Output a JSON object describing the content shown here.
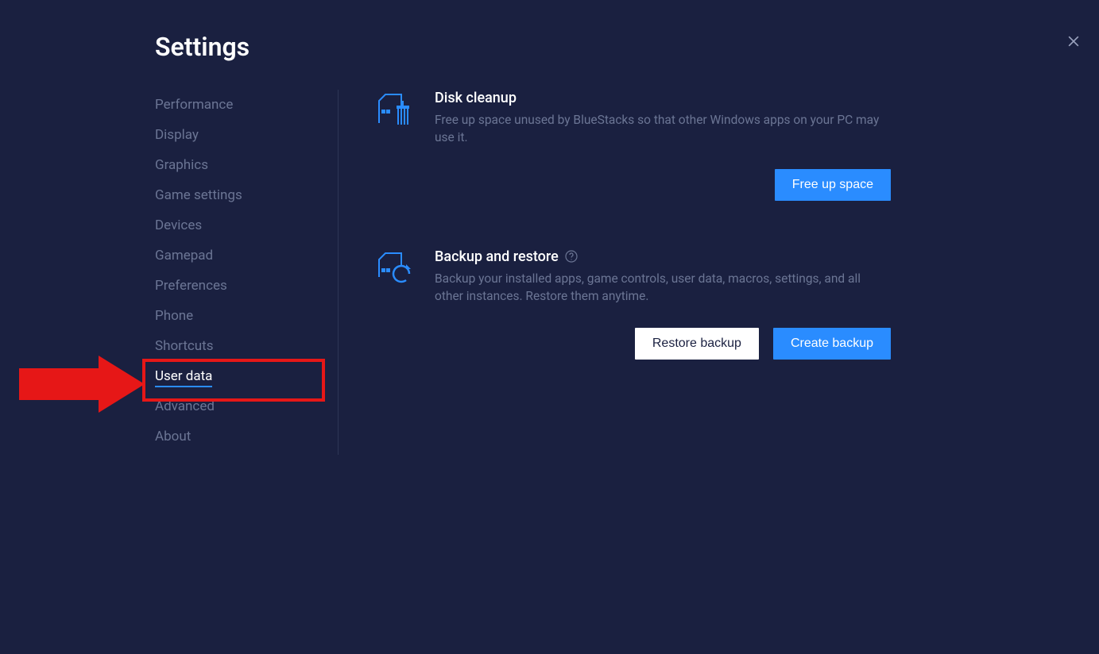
{
  "title": "Settings",
  "sidebar": {
    "items": [
      {
        "label": "Performance"
      },
      {
        "label": "Display"
      },
      {
        "label": "Graphics"
      },
      {
        "label": "Game settings"
      },
      {
        "label": "Devices"
      },
      {
        "label": "Gamepad"
      },
      {
        "label": "Preferences"
      },
      {
        "label": "Phone"
      },
      {
        "label": "Shortcuts"
      },
      {
        "label": "User data"
      },
      {
        "label": "Advanced"
      },
      {
        "label": "About"
      }
    ],
    "active_index": 9
  },
  "sections": {
    "disk": {
      "title": "Disk cleanup",
      "desc": "Free up space unused by BlueStacks so that other Windows apps on your PC may use it.",
      "button": "Free up space"
    },
    "backup": {
      "title": "Backup and restore",
      "desc": "Backup your installed apps, game controls, user data, macros, settings, and all other instances. Restore them anytime.",
      "restore_button": "Restore backup",
      "create_button": "Create backup"
    }
  },
  "annotation": {
    "highlighted_item": "User data"
  }
}
